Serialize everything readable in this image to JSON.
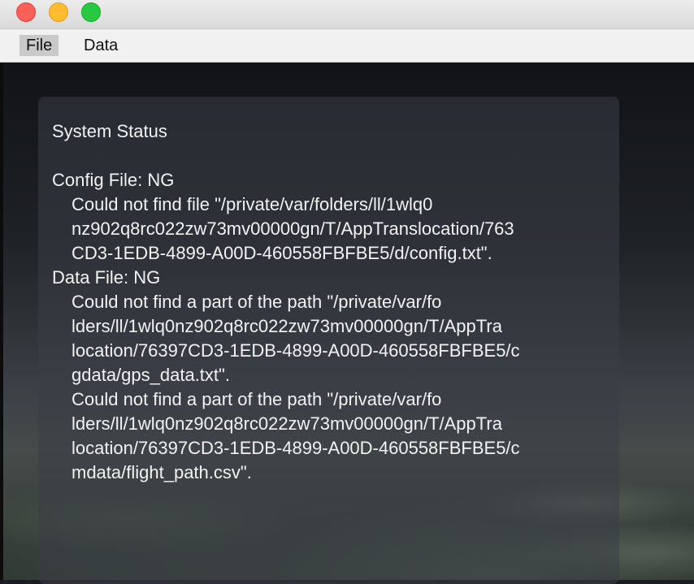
{
  "window": {
    "buttons": [
      "close",
      "minimize",
      "maximize"
    ],
    "colors": {
      "close": "#fe5f57",
      "minimize": "#febc2e",
      "maximize": "#28c840"
    }
  },
  "menu": {
    "file_label": "File",
    "data_label": "Data"
  },
  "status": {
    "title": "System Status",
    "sections": [
      {
        "heading": "Config File: NG",
        "lines": [
          "Could not find file \"/private/var/folders/ll/1wlq0",
          "nz902q8rc022zw73mv00000gn/T/AppTranslocation/763",
          "CD3-1EDB-4899-A00D-460558FBFBE5/d/config.txt\"."
        ]
      },
      {
        "heading": "Data File: NG",
        "lines": [
          "Could not find a part of the path \"/private/var/fo",
          "lders/ll/1wlq0nz902q8rc022zw73mv00000gn/T/AppTra",
          "location/76397CD3-1EDB-4899-A00D-460558FBFBE5/c",
          "gdata/gps_data.txt\".",
          "Could not find a part of the path \"/private/var/fo",
          "lders/ll/1wlq0nz902q8rc022zw73mv00000gn/T/AppTra",
          "location/76397CD3-1EDB-4899-A00D-460558FBFBE5/c",
          "mdata/flight_path.csv\"."
        ]
      }
    ]
  }
}
